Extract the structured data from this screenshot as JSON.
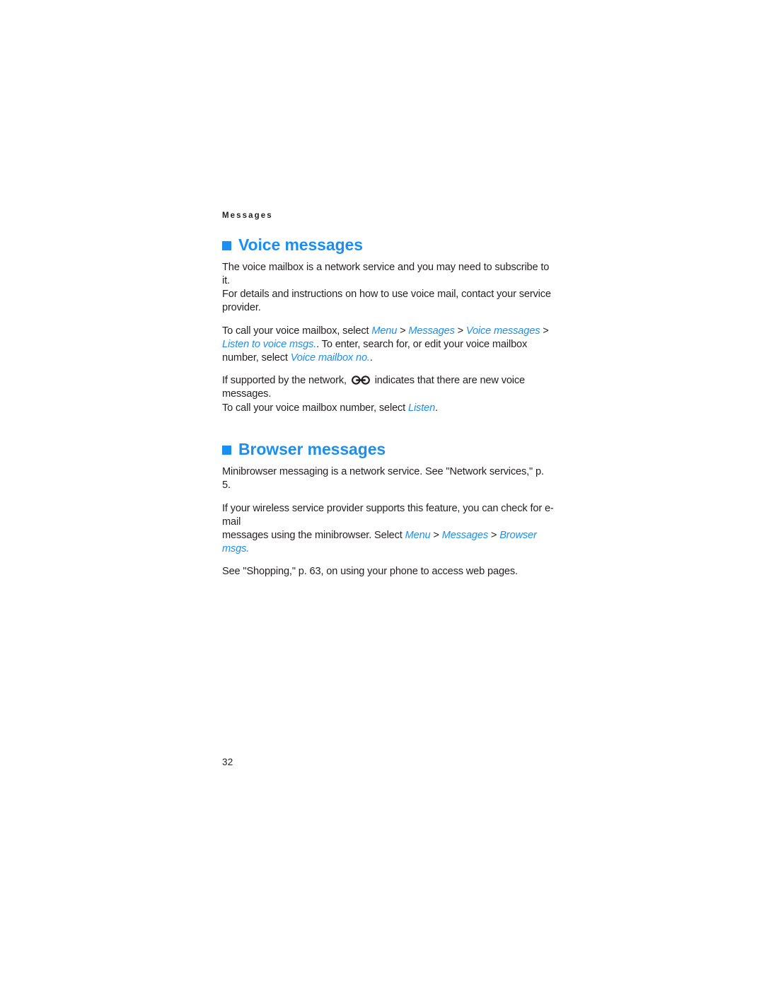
{
  "document": {
    "running_header": "Messages",
    "page_number": "32",
    "accent_color": "#1a8ff0",
    "text_color": "#231f20"
  },
  "sections": [
    {
      "id": "voice-messages",
      "heading": "Voice messages",
      "bullet_icon": "square-bullet-icon",
      "paragraphs": {
        "intro_line_1": "The voice mailbox is a network service and you may need to subscribe to it.",
        "intro_line_2": "For details and instructions on how to use voice mail, contact your service provider.",
        "path_lead": "To call your voice mailbox, select ",
        "path_terms": {
          "menu": "Menu",
          "messages": "Messages",
          "voice_messages": "Voice messages",
          "listen_to_voice_msgs_part1": "Listen",
          "listen_to_voice_msgs_part2": "to voice msgs."
        },
        "path_separator": ">",
        "path_tail": ". To enter, search for, or edit your voice mailbox number, select ",
        "voice_mailbox_no_term": "Voice mailbox no.",
        "voice_mailbox_no_tail": ".",
        "indicator_lead": "If supported by the network, ",
        "indicator_icon": "voicemail-cassette-icon",
        "indicator_tail": " indicates that there are new voice messages.",
        "listen_lead": "To call your voice mailbox number, select ",
        "listen_term": "Listen",
        "listen_tail": "."
      }
    },
    {
      "id": "browser-messages",
      "heading": "Browser messages",
      "bullet_icon": "square-bullet-icon",
      "paragraphs": {
        "network_service": "Minibrowser messaging is a network service. See \"Network services,\" p. 5.",
        "email_line_1": "If your wireless service provider supports this feature, you can check for e-mail",
        "email_line_2_lead": "messages using the minibrowser. Select ",
        "email_terms": {
          "menu": "Menu",
          "messages": "Messages",
          "browser_msgs": "Browser msgs."
        },
        "separator": ">",
        "shopping": "See \"Shopping,\" p. 63, on using your phone to access web pages."
      }
    }
  ]
}
